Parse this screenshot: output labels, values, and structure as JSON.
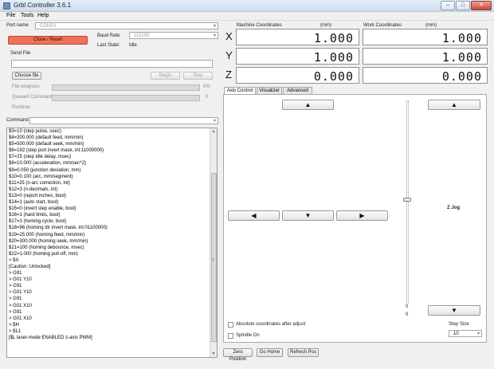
{
  "window": {
    "title": "Grbl Controller 3.6.1",
    "min": "–",
    "max": "□",
    "close": "✕"
  },
  "menu": {
    "file": "File",
    "tools": "Tools",
    "help": "Help"
  },
  "connection": {
    "port_label": "Port name",
    "port_value": "COM21",
    "close_reset": "Close / Reset",
    "baud_label": "Baud Rate",
    "baud_value": "115200",
    "last_state_label": "Last State:",
    "last_state_value": "Idle"
  },
  "send_file": {
    "label": "Send File",
    "path_value": "",
    "choose_file": "Choose file",
    "begin": "Begin",
    "stop": "Stop",
    "file_progress_label": "File progress",
    "file_progress_pct": "0%",
    "file_progress_fraction": 0,
    "queued_label": "Queued Commands",
    "queued_value": "0",
    "queued_fraction": 0,
    "runtime_label": "Runtime:"
  },
  "command": {
    "label": "Command",
    "value": ""
  },
  "console": {
    "lines": [
      "$3=10 (step pulse, usec)",
      "$4=300.000 (default feed, mm/min)",
      "$5=500.000 (default seek, mm/min)",
      "$6=192 (step port invert mask, int:11000000)",
      "$7=25 (step idle delay, msec)",
      "$8=10.000 (acceleration, mm/sec^2)",
      "$9=0.050 (junction deviation, mm)",
      "$10=0.100 (arc, mm/segment)",
      "$11=25 (n-arc correction, int)",
      "$12=3 (n-decimals, int)",
      "$13=0 (report inches, bool)",
      "$14=1 (auto start, bool)",
      "$15=0 (invert step enable, bool)",
      "$16=1 (hard limits, bool)",
      "$17=1 (homing cycle, bool)",
      "$18=96 (homing dir invert mask, int:01100000)",
      "$19=25.000 (homing feed, mm/min)",
      "$20=300.000 (homing seek, mm/min)",
      "$21=100 (homing debounce, msec)",
      "$22=1.000 (homing pull-off, mm)",
      "> $X",
      "[Caution: Unlocked]",
      "> G91",
      "> G01 Y10",
      "> G91",
      "> G01 Y10",
      "> G91",
      "> G01 X10",
      "> G91",
      "> G01 X10",
      "> $H",
      "> $L1",
      "[$L laser-mode ENABLED z-axis PWM]"
    ]
  },
  "coords": {
    "machine_label": "Machine Coordinates",
    "work_label": "Work Coordinates",
    "unit_machine": "(mm)",
    "unit_work": "(mm)",
    "axes": [
      {
        "axis": "X",
        "machine": "1.000",
        "work": "1.000"
      },
      {
        "axis": "Y",
        "machine": "1.000",
        "work": "1.000"
      },
      {
        "axis": "Z",
        "machine": "0.000",
        "work": "0.000"
      }
    ]
  },
  "tabs": [
    {
      "label": "Axis Control",
      "active": true
    },
    {
      "label": "Visualizer",
      "active": false
    },
    {
      "label": "Advanced",
      "active": false
    }
  ],
  "axis_control": {
    "up": "▲",
    "down": "▼",
    "left": "◀",
    "right": "▶",
    "z_up": "▲",
    "z_down": "▼",
    "z_jog_label": "Z Jog",
    "slider_top": "0",
    "slider_bottom": "0",
    "slider_value": 0,
    "absolute_coords": "Absolute coordinates after adjust",
    "spindle_on": "Spindle On",
    "step_size_label": "Step Size",
    "step_size_value": "10"
  },
  "bottom_buttons": {
    "zero": "Zero Position",
    "home": "Go Home",
    "refresh": "Refresh Pos"
  }
}
